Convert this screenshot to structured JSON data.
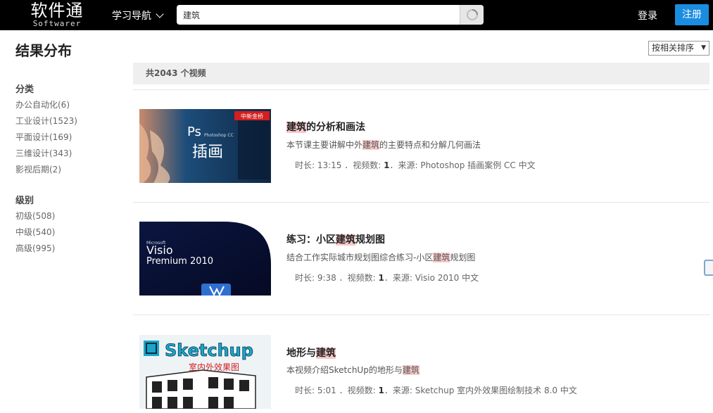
{
  "header": {
    "logo_cn": "软件通",
    "logo_en": "Softwarer",
    "nav_label": "学习导航",
    "search_value": "建筑",
    "login": "登录",
    "register": "注册"
  },
  "sidebar": {
    "title": "结果分布",
    "groups": [
      {
        "title": "分类",
        "items": [
          "办公自动化(6)",
          "工业设计(1523)",
          "平面设计(169)",
          "三维设计(343)",
          "影视后期(2)"
        ]
      },
      {
        "title": "级别",
        "items": [
          "初级(508)",
          "中级(540)",
          "高级(995)"
        ]
      }
    ]
  },
  "sort": {
    "selected": "按相关排序"
  },
  "results_summary": {
    "prefix": "共",
    "count": "2043",
    "suffix": " 个视频"
  },
  "results": [
    {
      "title_hl": "建筑",
      "title_rest": "的分析和画法",
      "desc_pre": "本节课主要讲解中外",
      "desc_hl": "建筑",
      "desc_post": "的主要特点和分解几何画法",
      "meta_duration": "时长: 13:15 ．视频数: ",
      "meta_count": "1",
      "meta_source": "．来源: Photoshop 插画案例 CC 中文",
      "thumb_text_1": "Ps",
      "thumb_text_2": "插画",
      "thumb_text_3": "Photoshop CC",
      "thumb_brand": "中新金桥"
    },
    {
      "title_pre": "练习：小区",
      "title_hl": "建筑",
      "title_rest": "规划图",
      "desc_pre": "结合工作实际城市规划图综合练习-小区",
      "desc_hl": "建筑",
      "desc_post": "规划图",
      "meta_duration": "时长: 9:38 ．视频数: ",
      "meta_count": "1",
      "meta_source": "．来源: Visio 2010 中文",
      "thumb_text_1": "Visio",
      "thumb_text_2": "Premium 2010",
      "thumb_text_3": "Microsoft"
    },
    {
      "title_pre": "地形与",
      "title_hl": "建筑",
      "desc_pre": "本视频介绍SketchUp的地形与",
      "desc_hl": "建筑",
      "meta_duration": "时长: 5:01 ．视频数: ",
      "meta_count": "1",
      "meta_source": "．来源: Sketchup 室内外效果图绘制技术 8.0 中文",
      "thumb_text_1": "Sketchup",
      "thumb_text_2": "室内外效果图"
    }
  ],
  "colors": {
    "header_bg": "#000000",
    "register_bg": "#1a8de0",
    "highlight": "#f6c9c9"
  }
}
